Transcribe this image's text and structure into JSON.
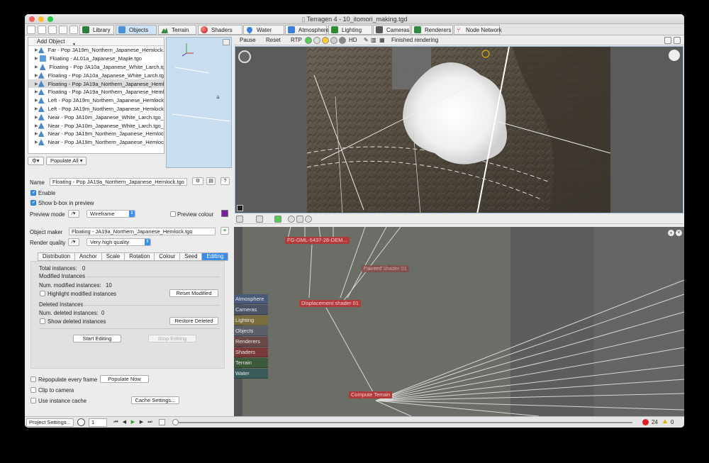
{
  "window": {
    "title": "Terragen 4 - 10_itomori_making.tgd",
    "title_icon": "document-icon"
  },
  "tabs": [
    {
      "label": "Library",
      "icon": "library-icon",
      "color": "#2a7d3c"
    },
    {
      "label": "Objects",
      "icon": "cube-icon",
      "color": "#4a90d9",
      "active": true
    },
    {
      "label": "Terrain",
      "icon": "terrain-icon",
      "color": "#3c8a3c"
    },
    {
      "label": "Shaders",
      "icon": "sphere-icon",
      "color": "#d33"
    },
    {
      "label": "Water",
      "icon": "water-drop-icon",
      "color": "#3a7fd5"
    },
    {
      "label": "Atmosphere",
      "icon": "atmosphere-icon",
      "color": "#3b7fd6"
    },
    {
      "label": "Lighting",
      "icon": "sun-icon",
      "color": "#2d8c2d"
    },
    {
      "label": "Cameras",
      "icon": "camera-icon",
      "color": "#555"
    },
    {
      "label": "Renderers",
      "icon": "image-icon",
      "color": "#2f8a3f"
    },
    {
      "label": "Node Network",
      "icon": "node-network-icon",
      "color": "#c23"
    }
  ],
  "objects_panel": {
    "add_object": "Add Object",
    "items": [
      {
        "label": "Far - Pop JA19m_Northern_Japanese_Hemlock.tg",
        "type": "pop"
      },
      {
        "label": "Floating - AL01a_Japanese_Maple.tgo",
        "type": "obj"
      },
      {
        "label": "Floating - Pop JA10a_Japanese_White_Larch.tg",
        "type": "pop"
      },
      {
        "label": "Floating - Pop JA10a_Japanese_White_Larch.tgo",
        "type": "pop"
      },
      {
        "label": "Floating - Pop JA19a_Northern_Japanese_Hemlo",
        "type": "pop",
        "selected": true
      },
      {
        "label": "Floating - Pop JA19a_Northern_Japanese_Hemlo",
        "type": "pop"
      },
      {
        "label": "Left - Pop JA19m_Northern_Japanese_Hemlock.t",
        "type": "pop"
      },
      {
        "label": "Left - Pop JA19m_Northern_Japanese_Hemlock.t",
        "type": "pop"
      },
      {
        "label": "Near - Pop JA10m_Japanese_White_Larch.tgo_1",
        "type": "pop"
      },
      {
        "label": "Near - Pop JA10m_Japanese_White_Larch.tgo_1/",
        "type": "pop"
      },
      {
        "label": "Near - Pop JA19m_Northern_Japanese_Hemlock",
        "type": "pop"
      },
      {
        "label": "Near - Pop JA19m_Northern_Japanese_Hemlock",
        "type": "pop"
      }
    ],
    "populate_all": "Populate All"
  },
  "properties": {
    "name_label": "Name",
    "name_value": "Floating - Pop JA19a_Northern_Japanese_Hemlock.tgo",
    "enable_label": "Enable",
    "enable_checked": true,
    "bbox_label": "Show b-box in preview",
    "bbox_checked": true,
    "preview_mode_label": "Preview mode",
    "preview_mode_value": "Wireframe",
    "preview_colour_label": "Preview colour",
    "preview_colour": "#7b1fa2",
    "object_maker_label": "Object maker",
    "object_maker_value": "Floating - JA19a_Northern_Japanese_Hemlock.tgo",
    "render_quality_label": "Render quality",
    "render_quality_value": "Very high quality",
    "subtabs": [
      "Distribution",
      "Anchor",
      "Scale",
      "Rotation",
      "Colour",
      "Seed",
      "Editing"
    ],
    "active_subtab": "Editing",
    "editing": {
      "total_instances_label": "Total instances:",
      "total_instances": "0",
      "modified_heading": "Modified Instances",
      "num_modified_label": "Num. modified instances:",
      "num_modified": "10",
      "highlight_modified": "Highlight modified instances",
      "reset_modified": "Reset Modified",
      "deleted_heading": "Deleted Instances",
      "num_deleted_label": "Num. deleted instances:",
      "num_deleted": "0",
      "show_deleted": "Show deleted instances",
      "restore_deleted": "Restore Deleted",
      "start_editing": "Start Editing",
      "stop_editing": "Stop Editing"
    },
    "repopulate_label": "Repopulate every frame",
    "populate_now": "Populate Now",
    "clip_label": "Clip to camera",
    "cache_label": "Use instance cache",
    "cache_settings": "Cache Settings..."
  },
  "render_toolbar": {
    "pause": "Pause",
    "reset": "Reset",
    "rtp": "RTP",
    "hd": "HD",
    "status": "Finished rendering"
  },
  "node_network": {
    "categories": [
      {
        "label": "Atmosphere",
        "color": "#4a5a7a"
      },
      {
        "label": "Cameras",
        "color": "#4d5366"
      },
      {
        "label": "Lighting",
        "color": "#7a6e3e"
      },
      {
        "label": "Objects",
        "color": "#5b5f6a"
      },
      {
        "label": "Renderers",
        "color": "#6a4848"
      },
      {
        "label": "Shaders",
        "color": "#7a3a3a"
      },
      {
        "label": "Terrain",
        "color": "#3d5a3a"
      },
      {
        "label": "Water",
        "color": "#3a5a5a"
      }
    ],
    "nodes": [
      {
        "label": "FG-GML-5437-26-DEM...",
        "color": "#b23a3a"
      },
      {
        "label": "Painted shader 01",
        "color": "#8a4a4a"
      },
      {
        "label": "Displacement shader 01",
        "color": "#b23a3a"
      },
      {
        "label": "Compute Terrain",
        "color": "#b23a3a"
      }
    ]
  },
  "statusbar": {
    "project_settings": "Project Settings...",
    "frame": "1",
    "errors": "24",
    "warnings": "0",
    "error_color": "#e02020",
    "warning_color": "#e0b000"
  }
}
